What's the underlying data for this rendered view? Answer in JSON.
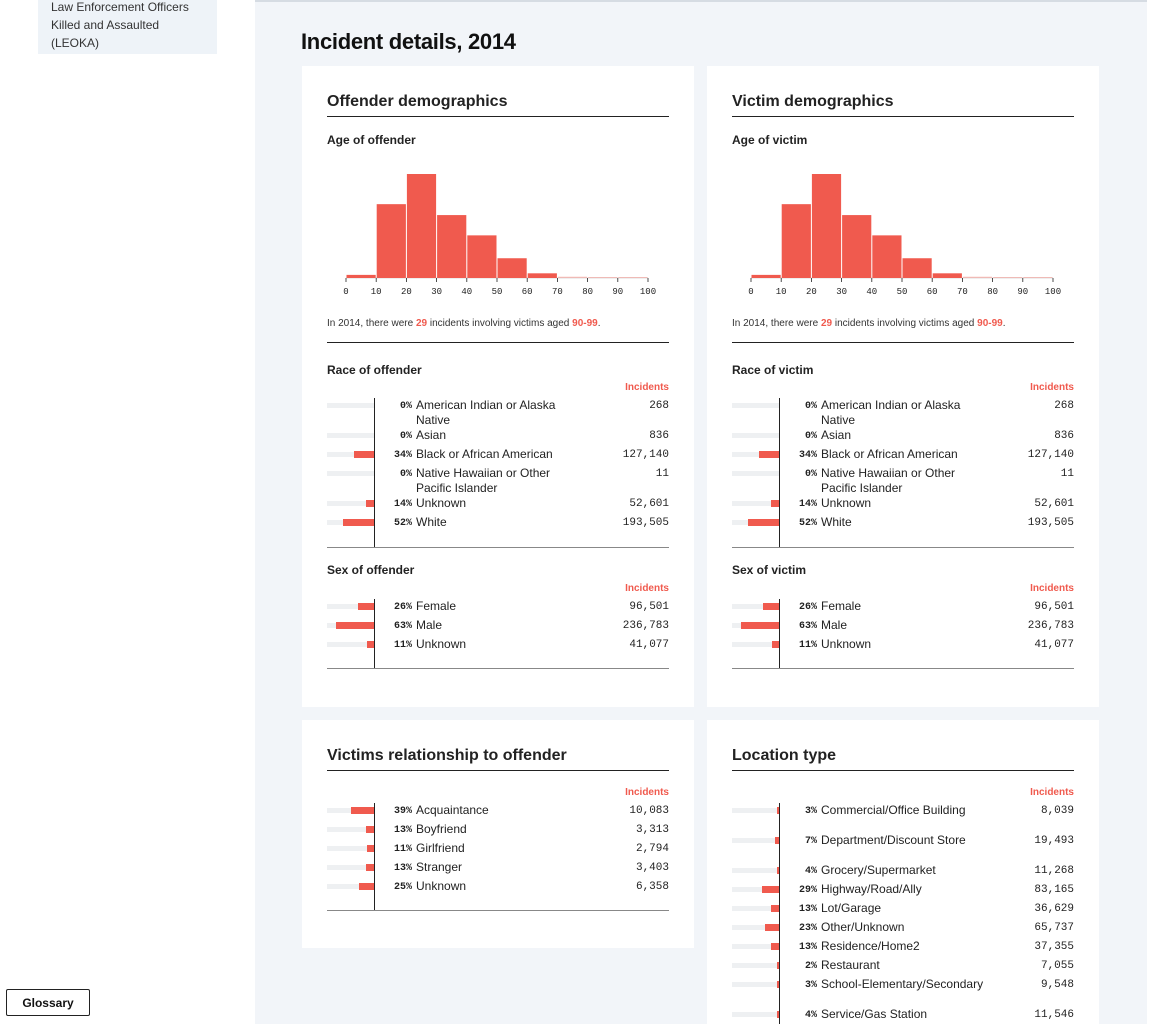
{
  "sidebar": {
    "nav_text": "Law Enforcement Officers Killed and Assaulted (LEOKA)"
  },
  "glossary_label": "Glossary",
  "page_title": "Incident details, 2014",
  "colors": {
    "accent": "#f05a4e",
    "panel_bg": "#f2f5f9",
    "track": "#eef0f2"
  },
  "offender": {
    "title": "Offender demographics",
    "age_title": "Age of offender",
    "age_caption": {
      "pre": "In 2014, there were ",
      "count": "29",
      "mid": " incidents involving victims aged ",
      "range": "90-99",
      "post": "."
    },
    "race_title": "Race of offender",
    "sex_title": "Sex of offender",
    "incidents_label": "Incidents"
  },
  "victim": {
    "title": "Victim demographics",
    "age_title": "Age of victim",
    "age_caption": {
      "pre": "In 2014, there were ",
      "count": "29",
      "mid": " incidents involving victims aged ",
      "range": "90-99",
      "post": "."
    },
    "race_title": "Race of victim",
    "sex_title": "Sex of victim",
    "incidents_label": "Incidents"
  },
  "relationship": {
    "title": "Victims relationship to offender",
    "incidents_label": "Incidents"
  },
  "location": {
    "title": "Location type",
    "incidents_label": "Incidents"
  },
  "chart_data": [
    {
      "type": "bar",
      "id": "offender-age",
      "title": "Age of offender",
      "categories": [
        "0-9",
        "10-19",
        "20-29",
        "30-39",
        "40-49",
        "50-59",
        "60-69",
        "70-79",
        "80-89",
        "90-99"
      ],
      "values": [
        6000,
        142000,
        200000,
        121000,
        82000,
        38000,
        9000,
        2500,
        600,
        29
      ],
      "xticks": [
        "0",
        "10",
        "20",
        "30",
        "40",
        "50",
        "60",
        "70",
        "80",
        "90",
        "100"
      ],
      "ylim": [
        0,
        200000
      ]
    },
    {
      "type": "bar",
      "id": "victim-age",
      "title": "Age of victim",
      "categories": [
        "0-9",
        "10-19",
        "20-29",
        "30-39",
        "40-49",
        "50-59",
        "60-69",
        "70-79",
        "80-89",
        "90-99"
      ],
      "values": [
        6000,
        142000,
        200000,
        121000,
        82000,
        38000,
        9000,
        2500,
        600,
        29
      ],
      "xticks": [
        "0",
        "10",
        "20",
        "30",
        "40",
        "50",
        "60",
        "70",
        "80",
        "90",
        "100"
      ],
      "ylim": [
        0,
        200000
      ]
    },
    {
      "type": "bar",
      "id": "offender-race",
      "title": "Race of offender",
      "rows": [
        {
          "pct": "0%",
          "label": "American Indian or Alaska Native",
          "count": "268",
          "value": 0
        },
        {
          "pct": "0%",
          "label": "Asian",
          "count": "836",
          "value": 0
        },
        {
          "pct": "34%",
          "label": "Black or African American",
          "count": "127,140",
          "value": 34
        },
        {
          "pct": "0%",
          "label": "Native Hawaiian or Other Pacific Islander",
          "count": "11",
          "value": 0
        },
        {
          "pct": "14%",
          "label": "Unknown",
          "count": "52,601",
          "value": 14
        },
        {
          "pct": "52%",
          "label": "White",
          "count": "193,505",
          "value": 52
        }
      ]
    },
    {
      "type": "bar",
      "id": "victim-race",
      "title": "Race of victim",
      "rows": [
        {
          "pct": "0%",
          "label": "American Indian or Alaska Native",
          "count": "268",
          "value": 0
        },
        {
          "pct": "0%",
          "label": "Asian",
          "count": "836",
          "value": 0
        },
        {
          "pct": "34%",
          "label": "Black or African American",
          "count": "127,140",
          "value": 34
        },
        {
          "pct": "0%",
          "label": "Native Hawaiian or Other Pacific Islander",
          "count": "11",
          "value": 0
        },
        {
          "pct": "14%",
          "label": "Unknown",
          "count": "52,601",
          "value": 14
        },
        {
          "pct": "52%",
          "label": "White",
          "count": "193,505",
          "value": 52
        }
      ]
    },
    {
      "type": "bar",
      "id": "offender-sex",
      "title": "Sex of offender",
      "rows": [
        {
          "pct": "26%",
          "label": "Female",
          "count": "96,501",
          "value": 26
        },
        {
          "pct": "63%",
          "label": "Male",
          "count": "236,783",
          "value": 63
        },
        {
          "pct": "11%",
          "label": "Unknown",
          "count": "41,077",
          "value": 11
        }
      ]
    },
    {
      "type": "bar",
      "id": "victim-sex",
      "title": "Sex of victim",
      "rows": [
        {
          "pct": "26%",
          "label": "Female",
          "count": "96,501",
          "value": 26
        },
        {
          "pct": "63%",
          "label": "Male",
          "count": "236,783",
          "value": 63
        },
        {
          "pct": "11%",
          "label": "Unknown",
          "count": "41,077",
          "value": 11
        }
      ]
    },
    {
      "type": "bar",
      "id": "relationship",
      "title": "Victims relationship to offender",
      "rows": [
        {
          "pct": "39%",
          "label": "Acquaintance",
          "count": "10,083",
          "value": 39
        },
        {
          "pct": "13%",
          "label": "Boyfriend",
          "count": "3,313",
          "value": 13
        },
        {
          "pct": "11%",
          "label": "Girlfriend",
          "count": "2,794",
          "value": 11
        },
        {
          "pct": "13%",
          "label": "Stranger",
          "count": "3,403",
          "value": 13
        },
        {
          "pct": "25%",
          "label": "Unknown",
          "count": "6,358",
          "value": 25
        }
      ]
    },
    {
      "type": "bar",
      "id": "location",
      "title": "Location type",
      "rows": [
        {
          "pct": "3%",
          "label": "Commercial/Office Building",
          "count": "8,039",
          "value": 3
        },
        {
          "pct": "7%",
          "label": "Department/Discount Store",
          "count": "19,493",
          "value": 7
        },
        {
          "pct": "4%",
          "label": "Grocery/Supermarket",
          "count": "11,268",
          "value": 4
        },
        {
          "pct": "29%",
          "label": "Highway/Road/Ally",
          "count": "83,165",
          "value": 29
        },
        {
          "pct": "13%",
          "label": "Lot/Garage",
          "count": "36,629",
          "value": 13
        },
        {
          "pct": "23%",
          "label": "Other/Unknown",
          "count": "65,737",
          "value": 23
        },
        {
          "pct": "13%",
          "label": "Residence/Home2",
          "count": "37,355",
          "value": 13
        },
        {
          "pct": "2%",
          "label": "Restaurant",
          "count": "7,055",
          "value": 2
        },
        {
          "pct": "3%",
          "label": "School-Elementary/Secondary",
          "count": "9,548",
          "value": 3
        },
        {
          "pct": "4%",
          "label": "Service/Gas Station",
          "count": "11,546",
          "value": 4
        }
      ]
    }
  ]
}
